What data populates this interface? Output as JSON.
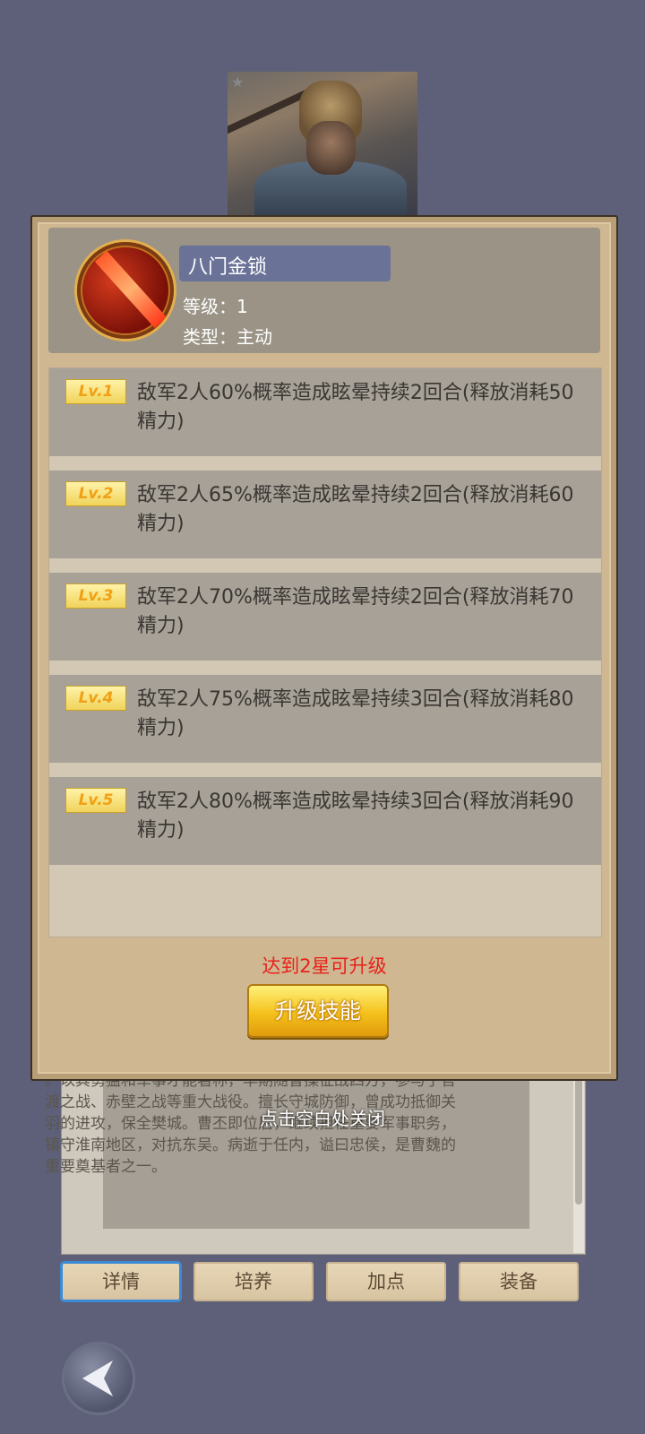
{
  "background_color": "#5d6078",
  "portrait": {
    "icon": "general-portrait-icon"
  },
  "bio": {
    "text": "。以其勇猛和军事才能著称，早期随曹操征战四方，参与了官渡之战、赤壁之战等重大战役。擅长守城防御，曾成功抵御关羽的进攻，保全樊城。曹丕即位后，继续担任重要军事职务，镇守淮南地区，对抗东吴。病逝于任内，谥曰忠侯，是曹魏的重要奠基者之一。"
  },
  "tabs": [
    "详情",
    "培养",
    "加点",
    "装备"
  ],
  "hint": "点击空白处关闭",
  "skill": {
    "name": "八门金锁",
    "level_label": "等级：",
    "level_value": "1",
    "type_label": "类型：",
    "type_value": "主动",
    "icon": "red-slash-skill-icon",
    "level_text": "等级：1",
    "type_text": "类型：主动"
  },
  "levels": [
    {
      "badge": "Lv.1",
      "desc": "敌军2人60%概率造成眩晕持续2回合(释放消耗50精力)"
    },
    {
      "badge": "Lv.2",
      "desc": "敌军2人65%概率造成眩晕持续2回合(释放消耗60精力)"
    },
    {
      "badge": "Lv.3",
      "desc": "敌军2人70%概率造成眩晕持续2回合(释放消耗70精力)"
    },
    {
      "badge": "Lv.4",
      "desc": "敌军2人75%概率造成眩晕持续3回合(释放消耗80精力)"
    },
    {
      "badge": "Lv.5",
      "desc": "敌军2人80%概率造成眩晕持续3回合(释放消耗90精力)"
    }
  ],
  "upgrade": {
    "tip": "达到2星可升级",
    "button": "升级技能"
  },
  "colors": {
    "accent_red": "#e8211b",
    "button_gold": "#f4c11c",
    "tab_active": "#3a8ad6"
  }
}
